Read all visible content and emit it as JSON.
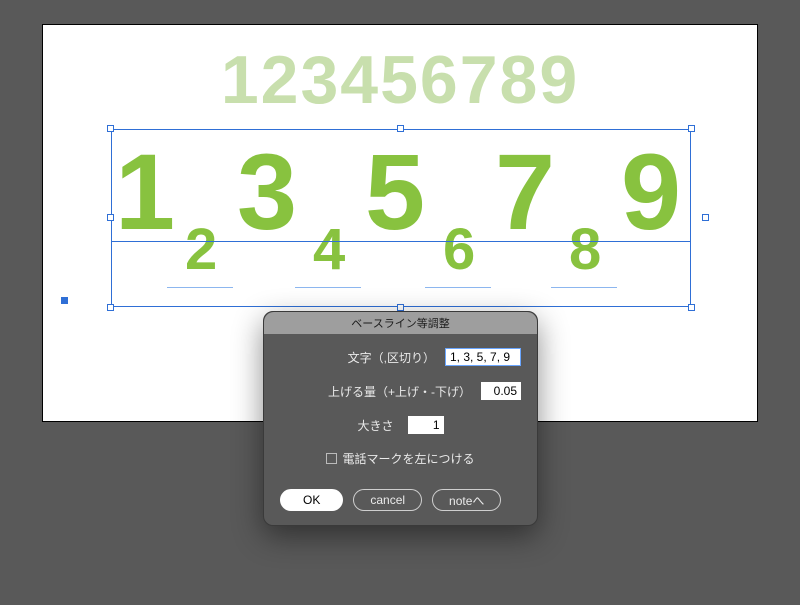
{
  "canvas": {
    "ghost_text": "123456789",
    "big_digits": [
      "1",
      "3",
      "5",
      "7",
      "9"
    ],
    "small_digits": [
      "2",
      "4",
      "6",
      "8"
    ]
  },
  "dialog": {
    "title": "ベースライン等調整",
    "field_chars_label": "文字（,区切り）",
    "field_chars_value": "1, 3, 5, 7, 9",
    "field_amount_label": "上げる量（+上げ・-下げ）",
    "field_amount_value": "0.05",
    "field_size_label": "大きさ",
    "field_size_value": "1",
    "checkbox_phone_label": "電話マークを左につける",
    "checkbox_phone_checked": false,
    "btn_ok": "OK",
    "btn_cancel": "cancel",
    "btn_note": "noteへ"
  }
}
